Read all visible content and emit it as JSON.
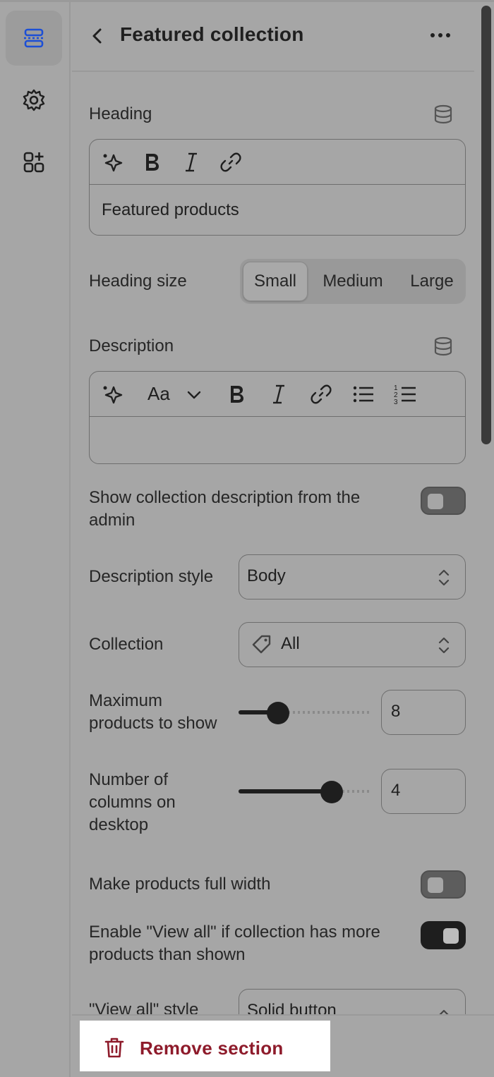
{
  "header": {
    "title": "Featured collection"
  },
  "heading": {
    "label": "Heading",
    "value": "Featured products"
  },
  "heading_size": {
    "label": "Heading size",
    "options": [
      "Small",
      "Medium",
      "Large"
    ],
    "selected": "Small"
  },
  "description": {
    "label": "Description",
    "font_control": "Aa",
    "value": ""
  },
  "show_collection_description": {
    "label_line1": "Show collection description from the",
    "label_line2": "admin",
    "enabled": false
  },
  "description_style": {
    "label": "Description style",
    "value": "Body"
  },
  "collection": {
    "label": "Collection",
    "value": "All"
  },
  "max_products": {
    "label_line1": "Maximum",
    "label_line2": "products to show",
    "value": "8",
    "slider_fraction": 0.3
  },
  "columns_desktop": {
    "label_line1": "Number of",
    "label_line2": "columns on",
    "label_line3": "desktop",
    "value": "4",
    "slider_fraction": 0.71
  },
  "full_width": {
    "label": "Make products full width",
    "enabled": false
  },
  "view_all": {
    "label_line1": "Enable \"View all\" if collection has more",
    "label_line2": "products than shown",
    "enabled": true
  },
  "view_all_style": {
    "label": "\"View all\" style",
    "value": "Solid button"
  },
  "footer": {
    "remove_label": "Remove section"
  },
  "colors": {
    "accent_blue": "#1c4fd6",
    "danger": "#8e1b2b",
    "toggle_on": "#1e1e1e"
  },
  "icons": [
    "sections-icon",
    "gear-icon",
    "add-app-block-icon",
    "back-chevron-icon",
    "more-dots-icon",
    "database-icon",
    "sparkle-icon",
    "bold-icon",
    "italic-icon",
    "link-icon",
    "text-size-icon",
    "bullet-list-icon",
    "numbered-list-icon",
    "tag-icon",
    "up-down-chevron-icon",
    "trash-icon"
  ]
}
